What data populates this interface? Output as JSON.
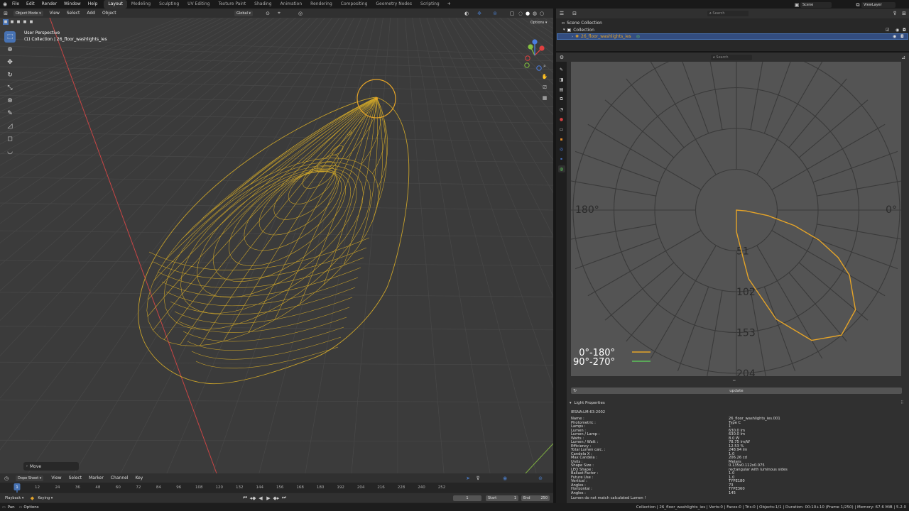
{
  "topbar": {
    "menus": [
      "File",
      "Edit",
      "Render",
      "Window",
      "Help"
    ],
    "workspaces": [
      "Layout",
      "Modeling",
      "Sculpting",
      "UV Editing",
      "Texture Paint",
      "Shading",
      "Animation",
      "Rendering",
      "Compositing",
      "Geometry Nodes",
      "Scripting"
    ],
    "active_workspace": "Layout",
    "add_tab": "+",
    "scene_label": "Scene",
    "viewlayer_label": "ViewLayer"
  },
  "viewport": {
    "mode": "Object Mode",
    "menus": [
      "View",
      "Select",
      "Add",
      "Object"
    ],
    "transform_orientation": "Global",
    "options_label": "Options",
    "perspective_label": "User Perspective",
    "collection_info": "(1) Collection | 26_floor_washlights_ies",
    "last_operator": "Move"
  },
  "outliner": {
    "search_placeholder": "Search",
    "scene_collection": "Scene Collection",
    "collection": "Collection",
    "object": "26_floor_washlights_ies"
  },
  "props": {
    "search_placeholder": "Search",
    "polar": {
      "label_180": "180°",
      "label_0": "0°",
      "radial_labels": [
        "51",
        "102",
        "153",
        "204"
      ],
      "legend": [
        {
          "name": "0°-180°",
          "color": "#e5a428"
        },
        {
          "name": "90°-270°",
          "color": "#5cc35a"
        }
      ],
      "curve_c0": [
        [
          0,
          27
        ],
        [
          10,
          87
        ],
        [
          20,
          145
        ],
        [
          30,
          188
        ],
        [
          40,
          204
        ],
        [
          50,
          194
        ],
        [
          60,
          163
        ],
        [
          65,
          140
        ],
        [
          70,
          110
        ],
        [
          75,
          75
        ],
        [
          80,
          40
        ],
        [
          85,
          12
        ],
        [
          90,
          0
        ]
      ]
    },
    "update_label": "update",
    "panel_title": "Light Properties",
    "ies_header": "IESNA:LM-63-2002",
    "rows": [
      {
        "k": "Name :",
        "v": "26_floor_washlights_ies.001"
      },
      {
        "k": "Photometric :",
        "v": "Type C"
      },
      {
        "k": "Lamps :",
        "v": "1"
      },
      {
        "k": "Lumen :",
        "v": "630.0 lm"
      },
      {
        "k": "Lumen / Lamp :",
        "v": "630.0 lm"
      },
      {
        "k": "Watts :",
        "v": "8.0 W"
      },
      {
        "k": "Lumen / Watt :",
        "v": "78.75 lm/W"
      },
      {
        "k": "Efficiency :",
        "v": "12.53 %"
      },
      {
        "k": "Total Lumen calc. :",
        "v": "248.94 lm"
      },
      {
        "k": "Candela X :",
        "v": "1.0"
      },
      {
        "k": "Max Candela :",
        "v": "206.26 cd"
      },
      {
        "k": "Units :",
        "v": "Meters"
      },
      {
        "k": "Shape Size :",
        "v": "0.135x0.112x0.075"
      },
      {
        "k": "LEO Shape :",
        "v": "rectangular with luminous sides"
      },
      {
        "k": "Ballast Factor :",
        "v": "1.0"
      },
      {
        "k": "Future Use :",
        "v": "1.0"
      },
      {
        "k": "Vertical :",
        "v": "TYPE180"
      },
      {
        "k": "Angles :",
        "v": "73"
      },
      {
        "k": "Horizontal :",
        "v": "TYPE360"
      },
      {
        "k": "Angles :",
        "v": "145"
      }
    ],
    "warning": "Lumen do not match calculated Lumen !"
  },
  "timeline": {
    "editor": "Dope Sheet",
    "menus": [
      "View",
      "Select",
      "Marker",
      "Channel",
      "Key"
    ],
    "ticks": [
      "1",
      "12",
      "24",
      "36",
      "48",
      "60",
      "72",
      "84",
      "96",
      "108",
      "120",
      "132",
      "144",
      "156",
      "168",
      "180",
      "192",
      "204",
      "216",
      "228",
      "240",
      "252"
    ],
    "playback_label": "Playback",
    "keying_label": "Keying",
    "current_frame": "1",
    "start_label": "Start",
    "start_value": "1",
    "end_label": "End",
    "end_value": "250"
  },
  "statusbar": {
    "pan_label": "Pan",
    "options_label": "Options",
    "info": "Collection | 26_floor_washlights_ies | Verts:0 | Faces:0 | Tris:0 | Objects:1/1 | Duration: 00:10+10 (Frame 1/250) | Memory: 67.6 MiB | 5.2.0"
  },
  "colors": {
    "selection": "#4772b3",
    "light": "#e5a428",
    "x_axis": "#e04040",
    "y_axis": "#84c040"
  }
}
